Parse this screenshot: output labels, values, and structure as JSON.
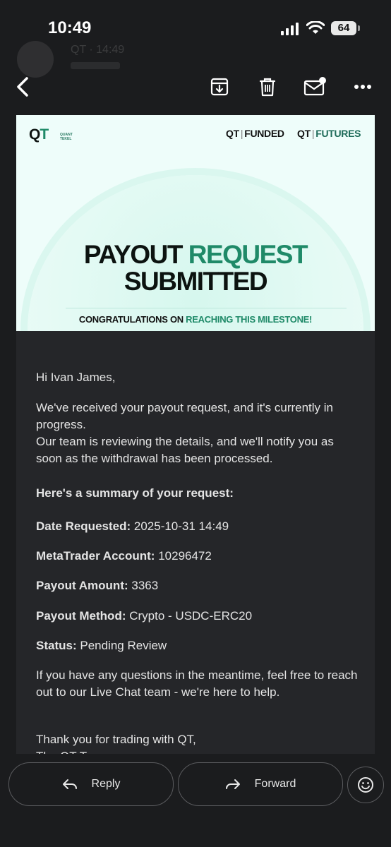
{
  "status_bar": {
    "time": "10:49",
    "battery": "64"
  },
  "ghost_header": {
    "sender_name": "QT · 14:49"
  },
  "toolbar": {
    "icons": [
      "back-arrow-icon",
      "archive-icon",
      "trash-icon",
      "mark-unread-icon",
      "more-icon"
    ]
  },
  "banner": {
    "logo_text": "QT",
    "logo_q": "Q",
    "logo_t": "T",
    "logo_small": "QUANT\nTEKEL",
    "brand1_prefix": "QT",
    "brand1_suffix": "FUNDED",
    "brand2_prefix": "QT",
    "brand2_suffix": "FUTURES",
    "brand_separator": "|",
    "headline_line1_dark": "PAYOUT",
    "headline_line1_accent": "REQUEST",
    "headline_line2": "SUBMITTED",
    "congrats_dark": "CONGRATULATIONS ON",
    "congrats_accent": "REACHING THIS MILESTONE!"
  },
  "email": {
    "greeting": "Hi Ivan James,",
    "para1_line1": "We've received your payout request, and it's currently in progress.",
    "para1_line2": "Our team is reviewing the details, and we'll notify you as soon as the withdrawal has been processed.",
    "summary_heading": "Here's a summary of your request:",
    "date_label": "Date Requested:",
    "date_value": "2025-10-31 14:49",
    "account_label": "MetaTrader Account:",
    "account_value": "10296472",
    "amount_label": "Payout Amount:",
    "amount_value": "3363",
    "method_label": "Payout Method:",
    "method_value": "Crypto - USDC-ERC20",
    "status_label": "Status:",
    "status_value": "Pending Review",
    "questions": "If you have any questions in the meantime, feel free to reach out to our Live Chat team - we're here to help.",
    "thanks": "Thank you for trading with QT,",
    "signoff_partial": "The QT Team"
  },
  "bottom": {
    "reply_label": "Reply",
    "forward_label": "Forward"
  },
  "colors": {
    "background": "#1b1c1e",
    "card": "#252629",
    "accent": "#1f8a68",
    "banner_bg": "#eefdfa"
  }
}
